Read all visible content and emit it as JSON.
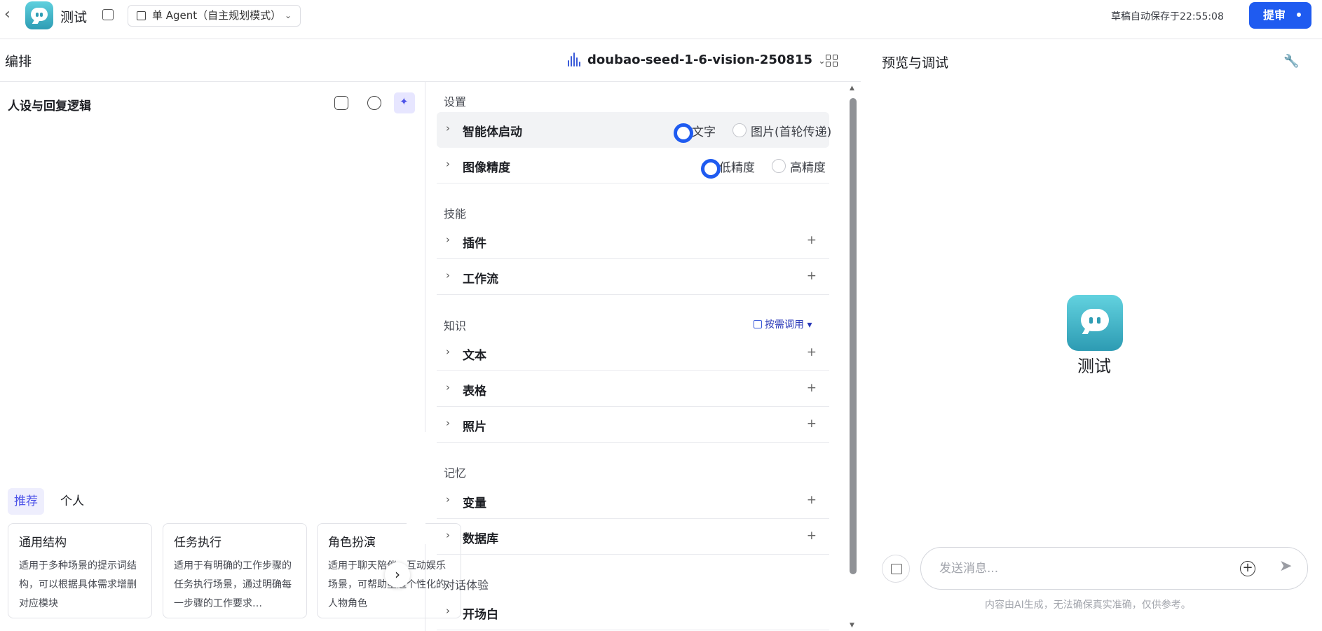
{
  "topbar": {
    "app_name": "测试",
    "agent_mode": "单 Agent（自主规划模式）",
    "autosave": "草稿自动保存于22:55:08",
    "submit_label": "提审"
  },
  "orchestration": {
    "title": "编排",
    "model_name": "doubao-seed-1-6-vision-250815"
  },
  "persona": {
    "title": "人设与回复逻辑",
    "tabs": [
      "推荐",
      "个人"
    ],
    "cards": [
      {
        "title": "通用结构",
        "desc": "适用于多种场景的提示词结构，可以根据具体需求增删对应模块"
      },
      {
        "title": "任务执行",
        "desc": "适用于有明确的工作步骤的任务执行场景，通过明确每一步骤的工作要求…"
      },
      {
        "title": "角色扮演",
        "desc": "适用于聊天陪伴、互动娱乐场景，可帮助塑造个性化的人物角色"
      }
    ]
  },
  "settings": {
    "section_settings": "设置",
    "agent_start": {
      "label": "智能体启动",
      "option1": "文字",
      "option2": "图片(首轮传递)"
    },
    "image_precision": {
      "label": "图像精度",
      "option1": "低精度",
      "option2": "高精度"
    },
    "section_skills": "技能",
    "skills": [
      "插件",
      "工作流"
    ],
    "section_knowledge": "知识",
    "on_demand": "按需调用",
    "knowledge": [
      "文本",
      "表格",
      "照片"
    ],
    "section_memory": "记忆",
    "memory": [
      "变量",
      "数据库"
    ],
    "section_dialog": "对话体验",
    "dialog": [
      "开场白"
    ]
  },
  "preview": {
    "title": "预览与调试",
    "bot_name": "测试",
    "input_placeholder": "发送消息...",
    "disclaimer": "内容由AI生成，无法确保真实准确，仅供参考。"
  },
  "colors": {
    "accent": "#1f5bf0",
    "tab_active": "#4d53e8"
  }
}
